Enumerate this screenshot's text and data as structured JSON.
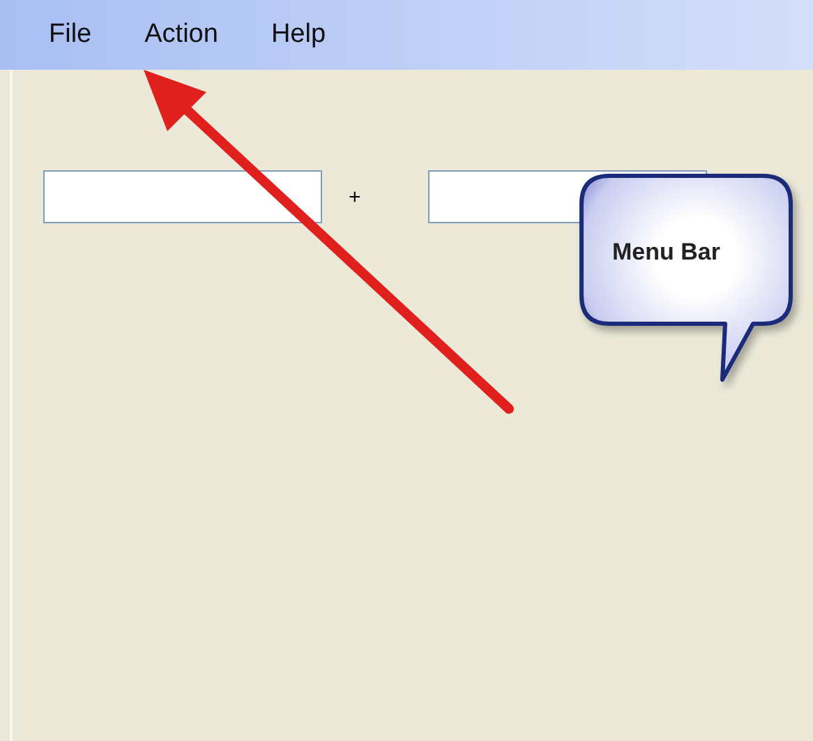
{
  "menu_bar": {
    "items": [
      {
        "label": "File"
      },
      {
        "label": "Action"
      },
      {
        "label": "Help"
      }
    ]
  },
  "form": {
    "operator": "+"
  },
  "callout": {
    "text": "Menu Bar"
  }
}
